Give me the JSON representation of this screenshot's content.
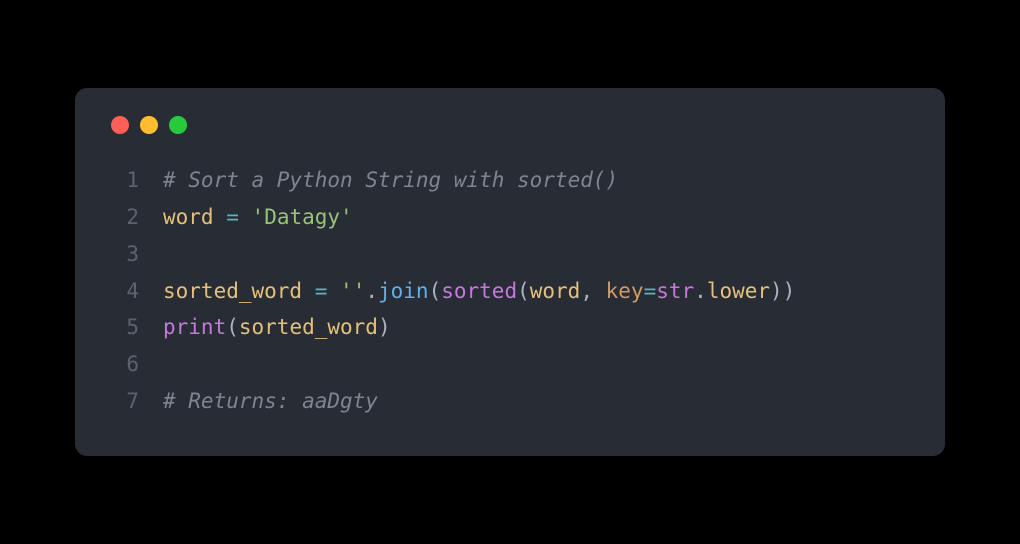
{
  "traffic_lights": [
    "red",
    "yellow",
    "green"
  ],
  "code": {
    "lines": [
      {
        "num": "1",
        "tokens": [
          {
            "cls": "tok-comment",
            "text": "# Sort a Python String with sorted()"
          }
        ]
      },
      {
        "num": "2",
        "tokens": [
          {
            "cls": "tok-ident",
            "text": "word"
          },
          {
            "cls": "tok-default",
            "text": " "
          },
          {
            "cls": "tok-operator",
            "text": "="
          },
          {
            "cls": "tok-default",
            "text": " "
          },
          {
            "cls": "tok-string",
            "text": "'Datagy'"
          }
        ]
      },
      {
        "num": "3",
        "tokens": []
      },
      {
        "num": "4",
        "tokens": [
          {
            "cls": "tok-ident",
            "text": "sorted_word"
          },
          {
            "cls": "tok-default",
            "text": " "
          },
          {
            "cls": "tok-operator",
            "text": "="
          },
          {
            "cls": "tok-default",
            "text": " "
          },
          {
            "cls": "tok-string",
            "text": "''"
          },
          {
            "cls": "tok-default",
            "text": "."
          },
          {
            "cls": "tok-func-call",
            "text": "join"
          },
          {
            "cls": "tok-default",
            "text": "("
          },
          {
            "cls": "tok-builtin",
            "text": "sorted"
          },
          {
            "cls": "tok-default",
            "text": "("
          },
          {
            "cls": "tok-ident",
            "text": "word"
          },
          {
            "cls": "tok-default",
            "text": ", "
          },
          {
            "cls": "tok-param",
            "text": "key"
          },
          {
            "cls": "tok-operator",
            "text": "="
          },
          {
            "cls": "tok-builtin",
            "text": "str"
          },
          {
            "cls": "tok-default",
            "text": "."
          },
          {
            "cls": "tok-ident",
            "text": "lower"
          },
          {
            "cls": "tok-default",
            "text": "))"
          }
        ]
      },
      {
        "num": "5",
        "tokens": [
          {
            "cls": "tok-builtin",
            "text": "print"
          },
          {
            "cls": "tok-default",
            "text": "("
          },
          {
            "cls": "tok-ident",
            "text": "sorted_word"
          },
          {
            "cls": "tok-default",
            "text": ")"
          }
        ]
      },
      {
        "num": "6",
        "tokens": []
      },
      {
        "num": "7",
        "tokens": [
          {
            "cls": "tok-comment",
            "text": "# Returns: aaDgty"
          }
        ]
      }
    ]
  }
}
